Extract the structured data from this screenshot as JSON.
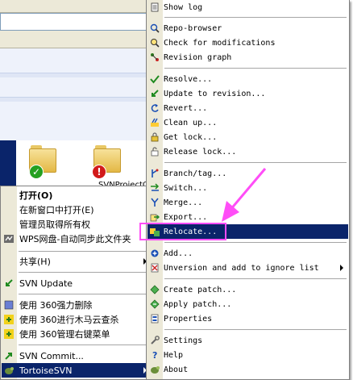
{
  "explorer": {
    "files": [
      {
        "name": "",
        "status": "ok"
      },
      {
        "name": "SVNProjectC",
        "status": "error"
      }
    ]
  },
  "context_menu": {
    "items": [
      {
        "label": "打开(O)",
        "bold": true,
        "icon": "none"
      },
      {
        "label": "在新窗口中打开(E)",
        "icon": "none"
      },
      {
        "label": "管理员取得所有权",
        "icon": "none"
      },
      {
        "label": "WPS网盘-自动同步此文件夹",
        "icon": "wps-cloud-icon"
      },
      {
        "label": "共享(H)",
        "icon": "none",
        "submenu": true
      },
      {
        "label": "SVN Update",
        "icon": "svn-update-icon"
      },
      {
        "label": "使用 360强力删除",
        "icon": "360-delete-icon"
      },
      {
        "label": "使用 360进行木马云查杀",
        "icon": "360-scan-icon"
      },
      {
        "label": "使用 360管理右键菜单",
        "icon": "360-menu-icon"
      },
      {
        "label": "SVN Commit...",
        "icon": "svn-commit-icon"
      },
      {
        "label": "TortoiseSVN",
        "icon": "tortoise-icon",
        "submenu": true,
        "selected": true
      }
    ]
  },
  "svn_menu": {
    "items": [
      {
        "label": "Show log",
        "icon": "log-icon"
      },
      {
        "label": "Repo-browser",
        "icon": "repo-browser-icon"
      },
      {
        "label": "Check for modifications",
        "icon": "check-modifications-icon"
      },
      {
        "label": "Revision graph",
        "icon": "revision-graph-icon"
      },
      {
        "label": "Resolve...",
        "icon": "resolve-icon"
      },
      {
        "label": "Update to revision...",
        "icon": "update-revision-icon"
      },
      {
        "label": "Revert...",
        "icon": "revert-icon"
      },
      {
        "label": "Clean up...",
        "icon": "cleanup-icon"
      },
      {
        "label": "Get lock...",
        "icon": "lock-icon"
      },
      {
        "label": "Release lock...",
        "icon": "unlock-icon"
      },
      {
        "label": "Branch/tag...",
        "icon": "branch-icon"
      },
      {
        "label": "Switch...",
        "icon": "switch-icon"
      },
      {
        "label": "Merge...",
        "icon": "merge-icon"
      },
      {
        "label": "Export...",
        "icon": "export-icon"
      },
      {
        "label": "Relocate...",
        "icon": "relocate-icon",
        "selected": true
      },
      {
        "label": "Add...",
        "icon": "add-icon"
      },
      {
        "label": "Unversion and add to ignore list",
        "icon": "ignore-icon",
        "submenu": true
      },
      {
        "label": "Create patch...",
        "icon": "create-patch-icon"
      },
      {
        "label": "Apply patch...",
        "icon": "apply-patch-icon"
      },
      {
        "label": "Properties",
        "icon": "properties-icon"
      },
      {
        "label": "Settings",
        "icon": "settings-icon"
      },
      {
        "label": "Help",
        "icon": "help-icon"
      },
      {
        "label": "About",
        "icon": "about-icon"
      }
    ]
  },
  "colors": {
    "selection": "#0a246a",
    "highlight_annotation": "#ff4df7"
  }
}
